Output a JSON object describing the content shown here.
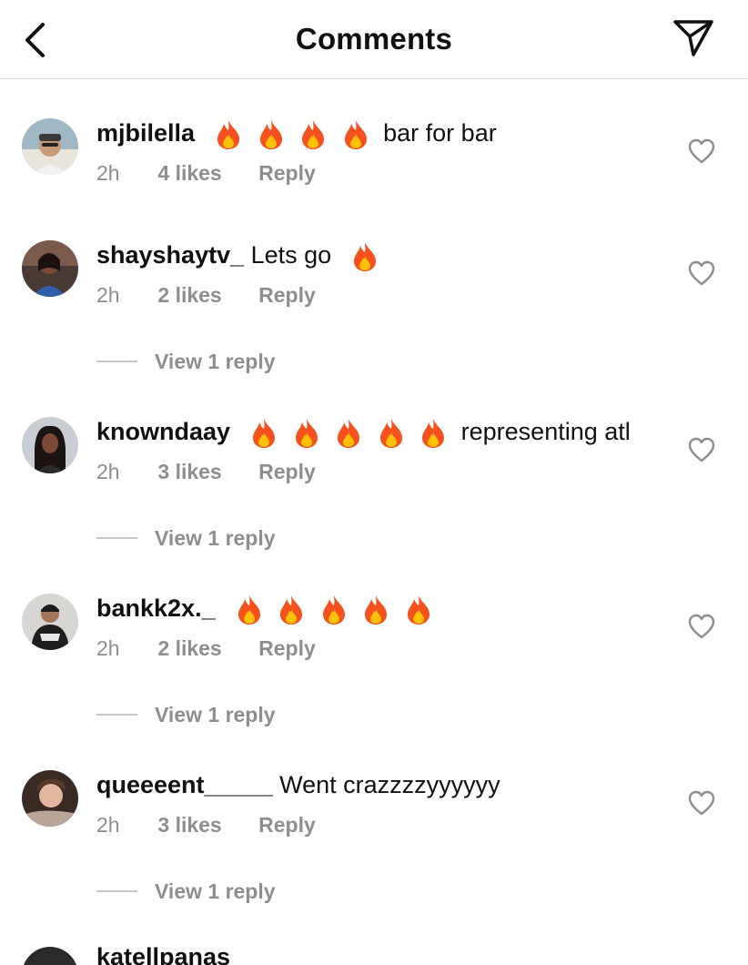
{
  "header": {
    "title": "Comments",
    "back_icon": "chevron-left-icon",
    "share_icon": "paper-plane-icon"
  },
  "comments": [
    {
      "username": "mjbilella",
      "fires": 4,
      "text": "bar for bar",
      "time": "2h",
      "likes": "4 likes",
      "reply": "Reply",
      "view_replies": ""
    },
    {
      "username": "shayshaytv_",
      "fires": 1,
      "text": "Lets go",
      "time": "2h",
      "likes": "2 likes",
      "reply": "Reply",
      "view_replies": "View 1 reply"
    },
    {
      "username": "knowndaay",
      "fires": 5,
      "text": "representing atl",
      "time": "2h",
      "likes": "3 likes",
      "reply": "Reply",
      "view_replies": "View 1 reply"
    },
    {
      "username": "bankk2x._",
      "fires": 5,
      "text": "",
      "time": "2h",
      "likes": "2 likes",
      "reply": "Reply",
      "view_replies": "View 1 reply"
    },
    {
      "username": "queeeent_____",
      "fires": 0,
      "text": "Went crazzzzyyyyyy",
      "time": "2h",
      "likes": "3 likes",
      "reply": "Reply",
      "view_replies": "View 1 reply"
    }
  ],
  "partial_comment": {
    "username": "katellpanas"
  },
  "colors": {
    "muted": "#8e8e8e",
    "divider": "#dbdbdb",
    "fire": "#f4511e"
  }
}
